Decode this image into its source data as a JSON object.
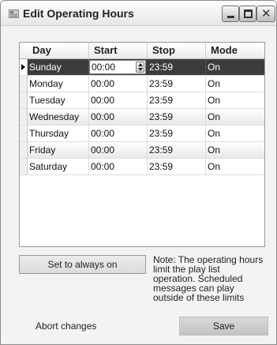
{
  "window": {
    "title": "Edit Operating Hours"
  },
  "grid": {
    "columns": [
      "Day",
      "Start",
      "Stop",
      "Mode"
    ],
    "rows": [
      {
        "day": "Sunday",
        "start": "00:00",
        "stop": "23:59",
        "mode": "On"
      },
      {
        "day": "Monday",
        "start": "00:00",
        "stop": "23:59",
        "mode": "On"
      },
      {
        "day": "Tuesday",
        "start": "00:00",
        "stop": "23:59",
        "mode": "On"
      },
      {
        "day": "Wednesday",
        "start": "00:00",
        "stop": "23:59",
        "mode": "On"
      },
      {
        "day": "Thursday",
        "start": "00:00",
        "stop": "23:59",
        "mode": "On"
      },
      {
        "day": "Friday",
        "start": "00:00",
        "stop": "23:59",
        "mode": "On"
      },
      {
        "day": "Saturday",
        "start": "00:00",
        "stop": "23:59",
        "mode": "On"
      }
    ]
  },
  "buttons": {
    "always_on": "Set to always on",
    "abort": "Abort changes",
    "save": "Save"
  },
  "note": {
    "lines": [
      "Note: The operating hours",
      "limit the play list",
      "operation. Scheduled",
      "messages can play",
      "outside of these limits"
    ]
  },
  "icons": {
    "app": "window-app-icon",
    "minimize": "minimize-icon",
    "maximize": "maximize-icon",
    "close": "close-icon",
    "row_indicator": "current-row-arrow-icon",
    "spinner": "spin-updown-icon"
  }
}
